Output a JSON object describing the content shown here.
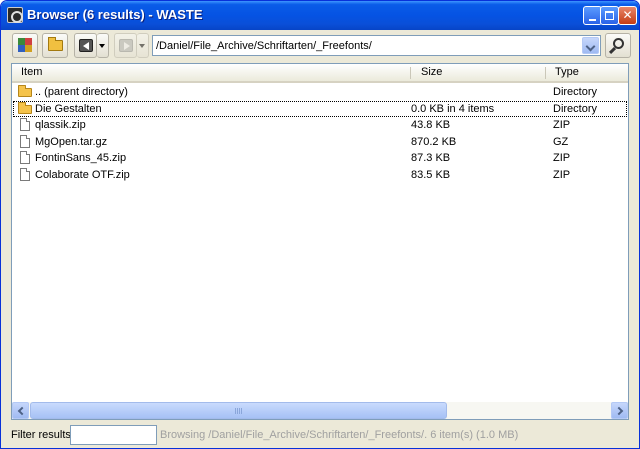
{
  "window": {
    "title": "Browser (6 results) - WASTE"
  },
  "toolbar": {
    "path_value": "/Daniel/File_Archive/Schriftarten/_Freefonts/"
  },
  "columns": [
    "Item",
    "Size",
    "Type"
  ],
  "rows": [
    {
      "icon": "folder-up-icon",
      "name": ".. (parent directory)",
      "size": "",
      "type": "Directory"
    },
    {
      "icon": "folder-icon",
      "name": "Die Gestalten",
      "size": "0.0 KB in 4 items",
      "type": "Directory"
    },
    {
      "icon": "file-icon",
      "name": "qlassik.zip",
      "size": "43.8 KB",
      "type": "ZIP"
    },
    {
      "icon": "file-icon",
      "name": "MgOpen.tar.gz",
      "size": "870.2 KB",
      "type": "GZ"
    },
    {
      "icon": "file-icon",
      "name": "FontinSans_45.zip",
      "size": "87.3 KB",
      "type": "ZIP"
    },
    {
      "icon": "file-icon",
      "name": "Colaborate OTF.zip",
      "size": "83.5 KB",
      "type": "ZIP"
    }
  ],
  "statusbar": {
    "filter_label": "Filter results:",
    "filter_value": "",
    "status_text": "Browsing /Daniel/File_Archive/Schriftarten/_Freefonts/. 6 item(s) (1.0 MB)"
  }
}
